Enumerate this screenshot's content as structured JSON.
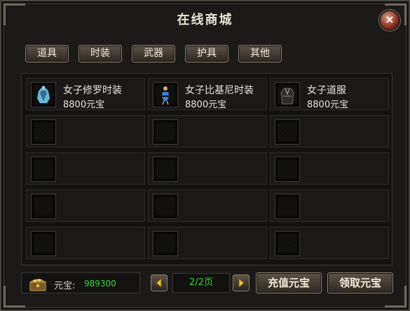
{
  "window": {
    "title": "在线商城",
    "close_label": "×"
  },
  "tabs": [
    {
      "label": "道具"
    },
    {
      "label": "时装"
    },
    {
      "label": "武器"
    },
    {
      "label": "护具"
    },
    {
      "label": "其他"
    }
  ],
  "items": [
    {
      "name": "女子修罗时装",
      "price": "8800元宝",
      "icon": "armor-blue-icon"
    },
    {
      "name": "女子比基尼时装",
      "price": "8800元宝",
      "icon": "bikini-costume-icon"
    },
    {
      "name": "女子道服",
      "price": "8800元宝",
      "icon": "robe-icon"
    }
  ],
  "bottom": {
    "currency_label": "元宝:",
    "currency_value": "989300",
    "page_indicator": "2/2页",
    "recharge_label": "充值元宝",
    "claim_label": "领取元宝"
  },
  "colors": {
    "accent_green": "#36d23a",
    "panel": "#1b1a18",
    "button_border": "#8b7f6d"
  }
}
